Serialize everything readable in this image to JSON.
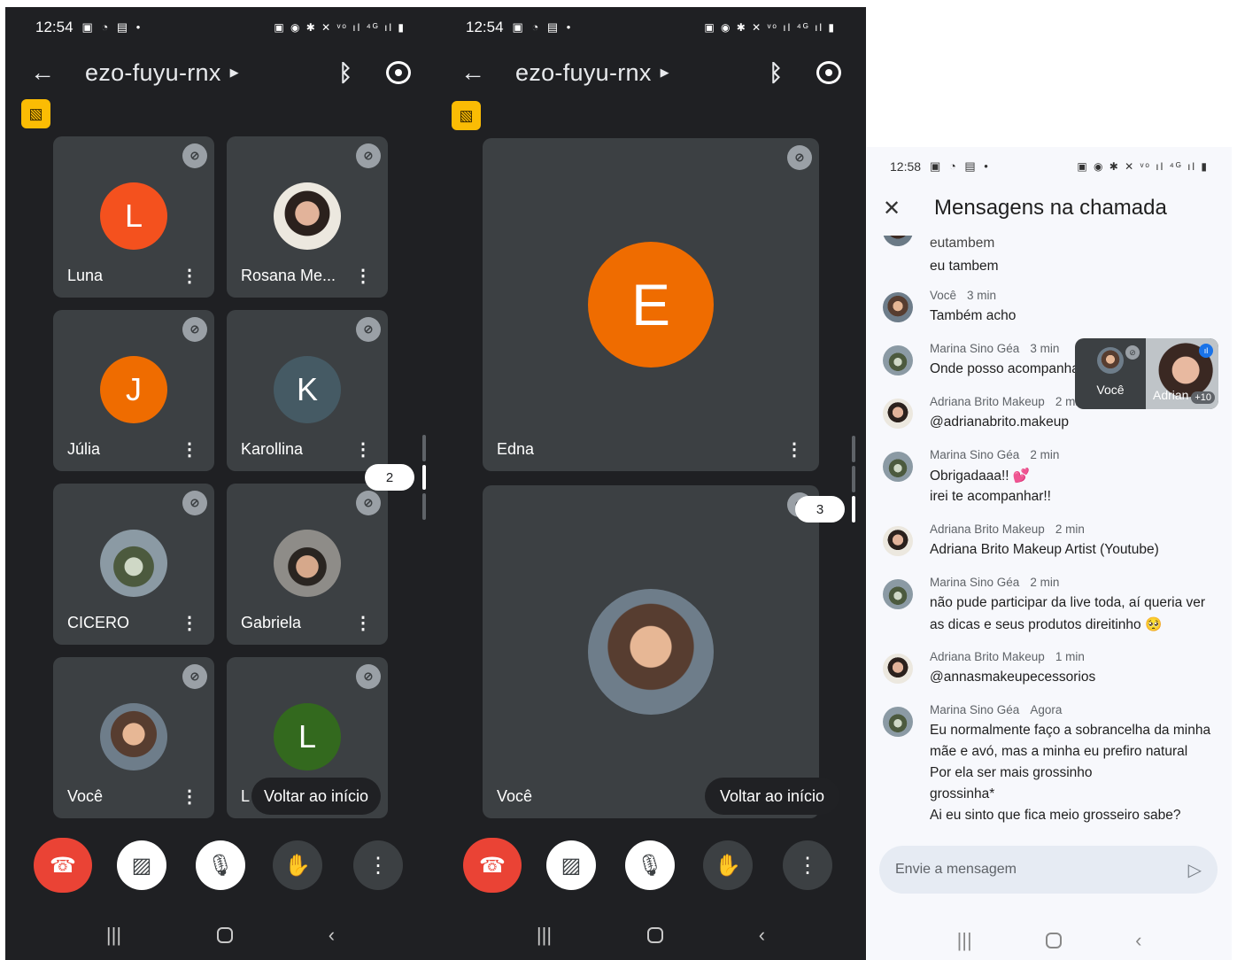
{
  "panel1": {
    "status": {
      "time": "12:54",
      "left_icons": "▣ ◔ ▤ •",
      "right_icons": "▣ ◉ ✱ ✕ ᵛᵒ ıl ⁴ᴳ ıl ▮"
    },
    "meeting_code": "ezo-fuyu-rnx",
    "participants": [
      {
        "name": "Luna",
        "initial": "L",
        "color": "#f4511e"
      },
      {
        "name": "Rosana Me...",
        "initial": "",
        "color": ""
      },
      {
        "name": "Júlia",
        "initial": "J",
        "color": "#ef6c00"
      },
      {
        "name": "Karollina",
        "initial": "K",
        "color": "#455a64"
      },
      {
        "name": "CICERO",
        "initial": "",
        "color": ""
      },
      {
        "name": "Gabriela",
        "initial": "",
        "color": ""
      },
      {
        "name": "Você",
        "initial": "",
        "color": ""
      },
      {
        "name": "L",
        "initial": "L",
        "color": "#33691e"
      }
    ],
    "page_indicator": "2",
    "resume_label": "Voltar ao início"
  },
  "panel2": {
    "status": {
      "time": "12:54",
      "left_icons": "▣ ◔ ▤ •",
      "right_icons": "▣ ◉ ✱ ✕ ᵛᵒ ıl ⁴ᴳ ıl ▮"
    },
    "meeting_code": "ezo-fuyu-rnx",
    "participants": [
      {
        "name": "Edna",
        "initial": "E",
        "color": "#ef6c00"
      },
      {
        "name": "Você",
        "initial": "",
        "color": ""
      }
    ],
    "page_indicator": "3",
    "resume_label": "Voltar ao início"
  },
  "chat": {
    "status": {
      "time": "12:58",
      "left_icons": "▣ ◔ ▤ •",
      "right_icons": "▣ ◉ ✱ ✕ ᵛᵒ ıl ⁴ᴳ ıl ▮"
    },
    "title": "Mensagens na chamada",
    "partial_lines": [
      "eutambem",
      "eu tambem"
    ],
    "messages": [
      {
        "sender": "Você",
        "ago": "3 min",
        "lines": [
          "Também acho"
        ]
      },
      {
        "sender": "Marina Sino Géa",
        "ago": "3 min",
        "lines": [
          "Onde posso acompanhar seu trabalho??"
        ]
      },
      {
        "sender": "Adriana Brito Makeup",
        "ago": "2 min",
        "lines": [
          "@adrianabrito.makeup"
        ]
      },
      {
        "sender": "Marina Sino Géa",
        "ago": "2 min",
        "lines": [
          "Obrigadaaa!! 💕",
          "irei te acompanhar!!"
        ]
      },
      {
        "sender": "Adriana Brito Makeup",
        "ago": "2 min",
        "lines": [
          "Adriana Brito Makeup Artist (Youtube)"
        ]
      },
      {
        "sender": "Marina Sino Géa",
        "ago": "2 min",
        "lines": [
          "não pude participar da live toda, aí queria ver",
          "as dicas e seus produtos direitinho 🥺"
        ]
      },
      {
        "sender": "Adriana Brito Makeup",
        "ago": "1 min",
        "lines": [
          "@annasmakeupecessorios"
        ]
      },
      {
        "sender": "Marina Sino Géa",
        "ago": "Agora",
        "lines": [
          "Eu normalmente faço a sobrancelha da minha",
          "mãe e avó, mas a minha eu prefiro natural",
          "Por ela ser mais grossinho",
          "grossinha*",
          "Ai eu sinto que fica meio grosseiro sabe?"
        ]
      }
    ],
    "pip": {
      "self_label": "Você",
      "other_label": "Adrian",
      "more_count": "+10"
    },
    "compose_placeholder": "Envie a mensagem"
  }
}
